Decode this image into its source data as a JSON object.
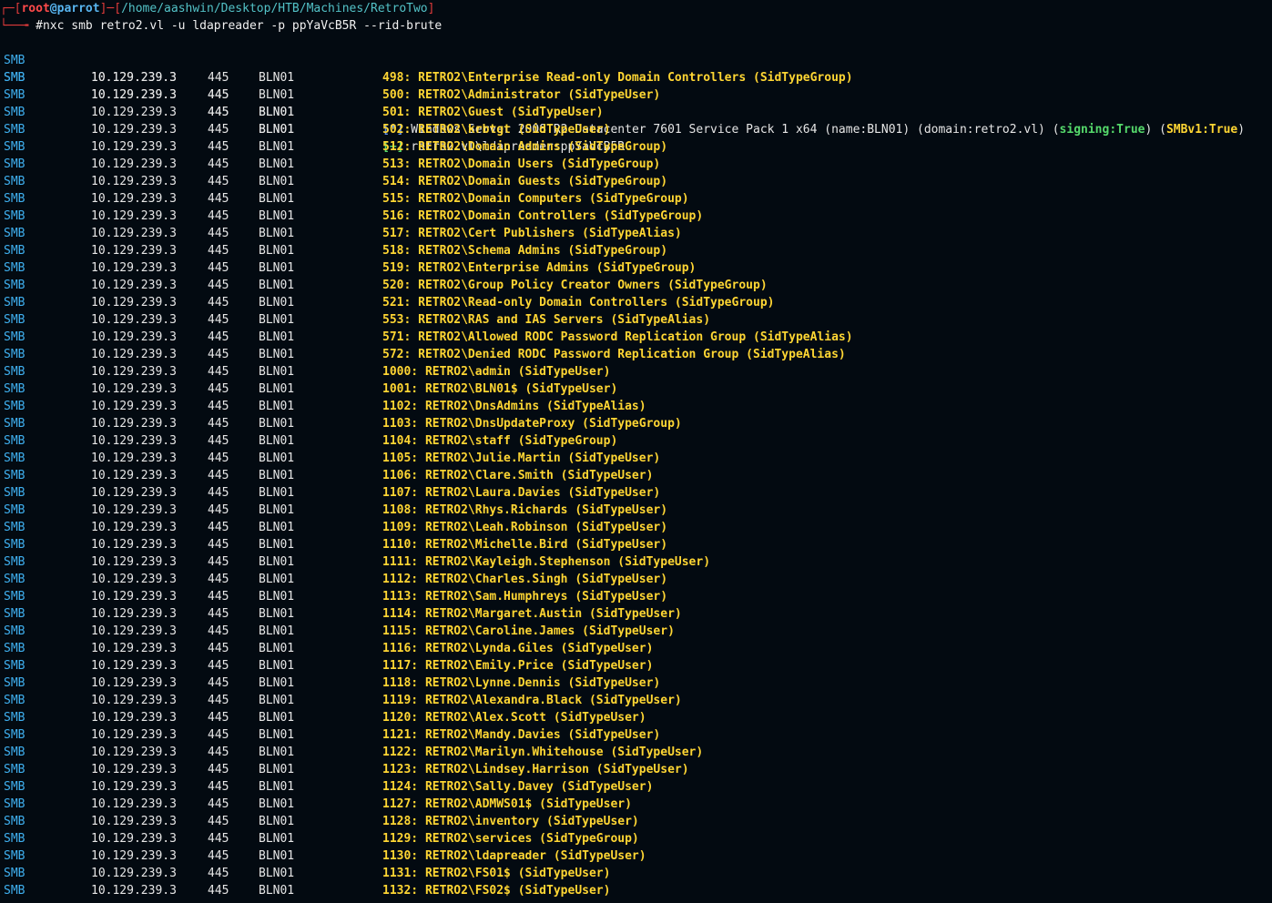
{
  "prompt": {
    "user": "root",
    "at": "@",
    "host": "parrot",
    "path": "/home/aashwin/Desktop/HTB/Machines/RetroTwo",
    "command": "#nxc smb retro2.vl -u ldapreader -p ppYaVcB5R --rid-brute"
  },
  "row_prefix": {
    "proto": "SMB",
    "ip": "10.129.239.3",
    "port": "445",
    "netbios": "BLN01"
  },
  "info_line": {
    "marker": "[*]",
    "text": " Windows Server 2008 R2 Datacenter 7601 Service Pack 1 x64 (name:BLN01) (domain:retro2.vl) (",
    "signing": "signing:True",
    "mid": ") (",
    "smbv1": "SMBv1:True",
    "end": ")"
  },
  "auth_line": {
    "marker": "[+]",
    "text": " retro2.vl\\ldapreader:ppYaVcB5R"
  },
  "rid_lines": [
    "498: RETRO2\\Enterprise Read-only Domain Controllers (SidTypeGroup)",
    "500: RETRO2\\Administrator (SidTypeUser)",
    "501: RETRO2\\Guest (SidTypeUser)",
    "502: RETRO2\\krbtgt (SidTypeUser)",
    "512: RETRO2\\Domain Admins (SidTypeGroup)",
    "513: RETRO2\\Domain Users (SidTypeGroup)",
    "514: RETRO2\\Domain Guests (SidTypeGroup)",
    "515: RETRO2\\Domain Computers (SidTypeGroup)",
    "516: RETRO2\\Domain Controllers (SidTypeGroup)",
    "517: RETRO2\\Cert Publishers (SidTypeAlias)",
    "518: RETRO2\\Schema Admins (SidTypeGroup)",
    "519: RETRO2\\Enterprise Admins (SidTypeGroup)",
    "520: RETRO2\\Group Policy Creator Owners (SidTypeGroup)",
    "521: RETRO2\\Read-only Domain Controllers (SidTypeGroup)",
    "553: RETRO2\\RAS and IAS Servers (SidTypeAlias)",
    "571: RETRO2\\Allowed RODC Password Replication Group (SidTypeAlias)",
    "572: RETRO2\\Denied RODC Password Replication Group (SidTypeAlias)",
    "1000: RETRO2\\admin (SidTypeUser)",
    "1001: RETRO2\\BLN01$ (SidTypeUser)",
    "1102: RETRO2\\DnsAdmins (SidTypeAlias)",
    "1103: RETRO2\\DnsUpdateProxy (SidTypeGroup)",
    "1104: RETRO2\\staff (SidTypeGroup)",
    "1105: RETRO2\\Julie.Martin (SidTypeUser)",
    "1106: RETRO2\\Clare.Smith (SidTypeUser)",
    "1107: RETRO2\\Laura.Davies (SidTypeUser)",
    "1108: RETRO2\\Rhys.Richards (SidTypeUser)",
    "1109: RETRO2\\Leah.Robinson (SidTypeUser)",
    "1110: RETRO2\\Michelle.Bird (SidTypeUser)",
    "1111: RETRO2\\Kayleigh.Stephenson (SidTypeUser)",
    "1112: RETRO2\\Charles.Singh (SidTypeUser)",
    "1113: RETRO2\\Sam.Humphreys (SidTypeUser)",
    "1114: RETRO2\\Margaret.Austin (SidTypeUser)",
    "1115: RETRO2\\Caroline.James (SidTypeUser)",
    "1116: RETRO2\\Lynda.Giles (SidTypeUser)",
    "1117: RETRO2\\Emily.Price (SidTypeUser)",
    "1118: RETRO2\\Lynne.Dennis (SidTypeUser)",
    "1119: RETRO2\\Alexandra.Black (SidTypeUser)",
    "1120: RETRO2\\Alex.Scott (SidTypeUser)",
    "1121: RETRO2\\Mandy.Davies (SidTypeUser)",
    "1122: RETRO2\\Marilyn.Whitehouse (SidTypeUser)",
    "1123: RETRO2\\Lindsey.Harrison (SidTypeUser)",
    "1124: RETRO2\\Sally.Davey (SidTypeUser)",
    "1127: RETRO2\\ADMWS01$ (SidTypeUser)",
    "1128: RETRO2\\inventory (SidTypeUser)",
    "1129: RETRO2\\services (SidTypeGroup)",
    "1130: RETRO2\\ldapreader (SidTypeUser)",
    "1131: RETRO2\\FS01$ (SidTypeUser)",
    "1132: RETRO2\\FS02$ (SidTypeUser)"
  ],
  "colors": {
    "background": "#030a11",
    "prompt_red": "#e23b3b",
    "host_blue": "#58b5f0",
    "path_cyan": "#53c2c7",
    "smb_blue": "#3fb0f0",
    "rid_yellow": "#ffd633",
    "success_green": "#55d96b"
  }
}
